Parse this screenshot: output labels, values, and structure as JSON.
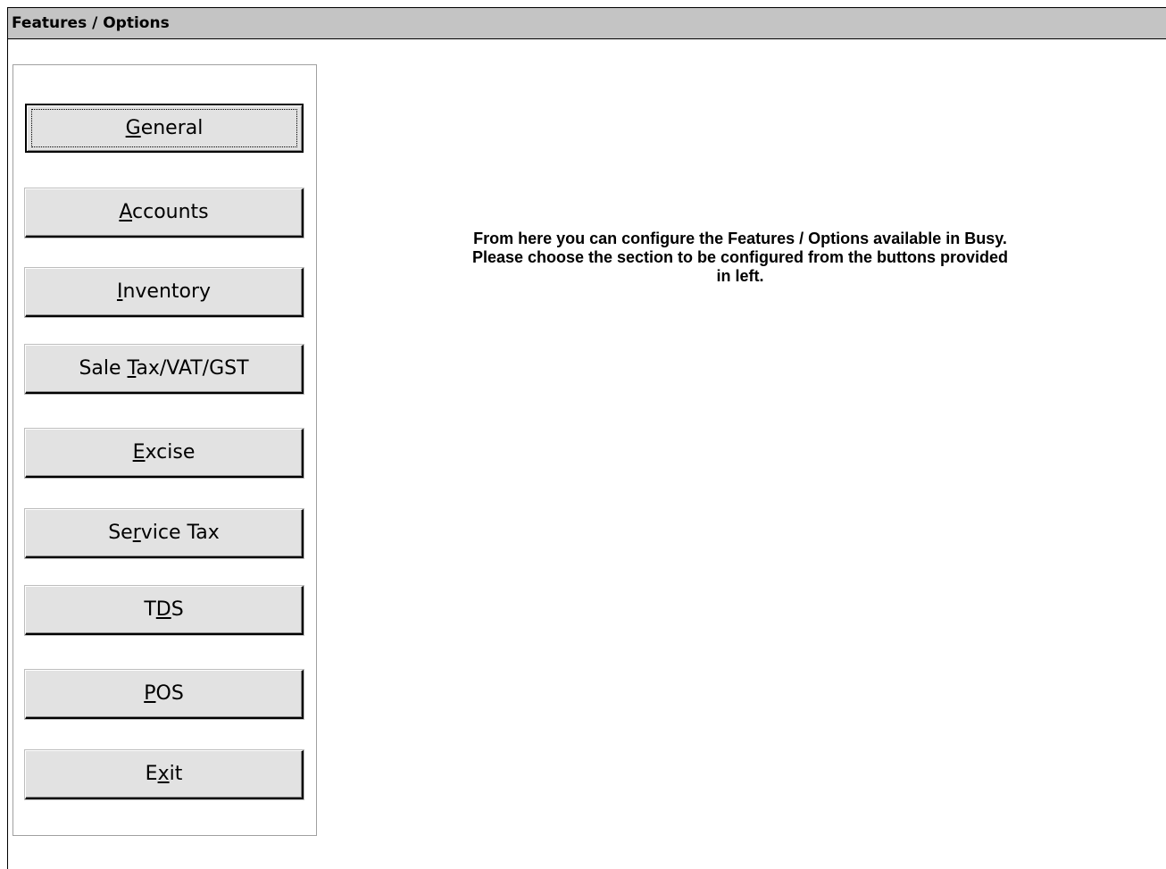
{
  "window": {
    "title": "Features / Options"
  },
  "buttons": [
    {
      "id": "general",
      "pre": "",
      "mnemonic": "G",
      "post": "eneral",
      "active": true
    },
    {
      "id": "accounts",
      "pre": "",
      "mnemonic": "A",
      "post": "ccounts",
      "active": false
    },
    {
      "id": "inventory",
      "pre": "",
      "mnemonic": "I",
      "post": "nventory",
      "active": false
    },
    {
      "id": "sale-tax",
      "pre": "Sale ",
      "mnemonic": "T",
      "post": "ax/VAT/GST",
      "active": false
    },
    {
      "id": "excise",
      "pre": "",
      "mnemonic": "E",
      "post": "xcise",
      "active": false
    },
    {
      "id": "service-tax",
      "pre": "Se",
      "mnemonic": "r",
      "post": "vice Tax",
      "active": false
    },
    {
      "id": "tds",
      "pre": "T",
      "mnemonic": "D",
      "post": "S",
      "active": false
    },
    {
      "id": "pos",
      "pre": "",
      "mnemonic": "P",
      "post": "OS",
      "active": false
    },
    {
      "id": "exit",
      "pre": "E",
      "mnemonic": "x",
      "post": "it",
      "active": false
    }
  ],
  "info": {
    "lines": [
      "From here you can configure the Features / Options available in Busy.",
      "Please choose the section to be configured from the buttons provided",
      "in left."
    ]
  },
  "colors": {
    "titlebar": "#c4c4c4",
    "button_face": "#e2e2e2",
    "background": "#ffffff"
  }
}
